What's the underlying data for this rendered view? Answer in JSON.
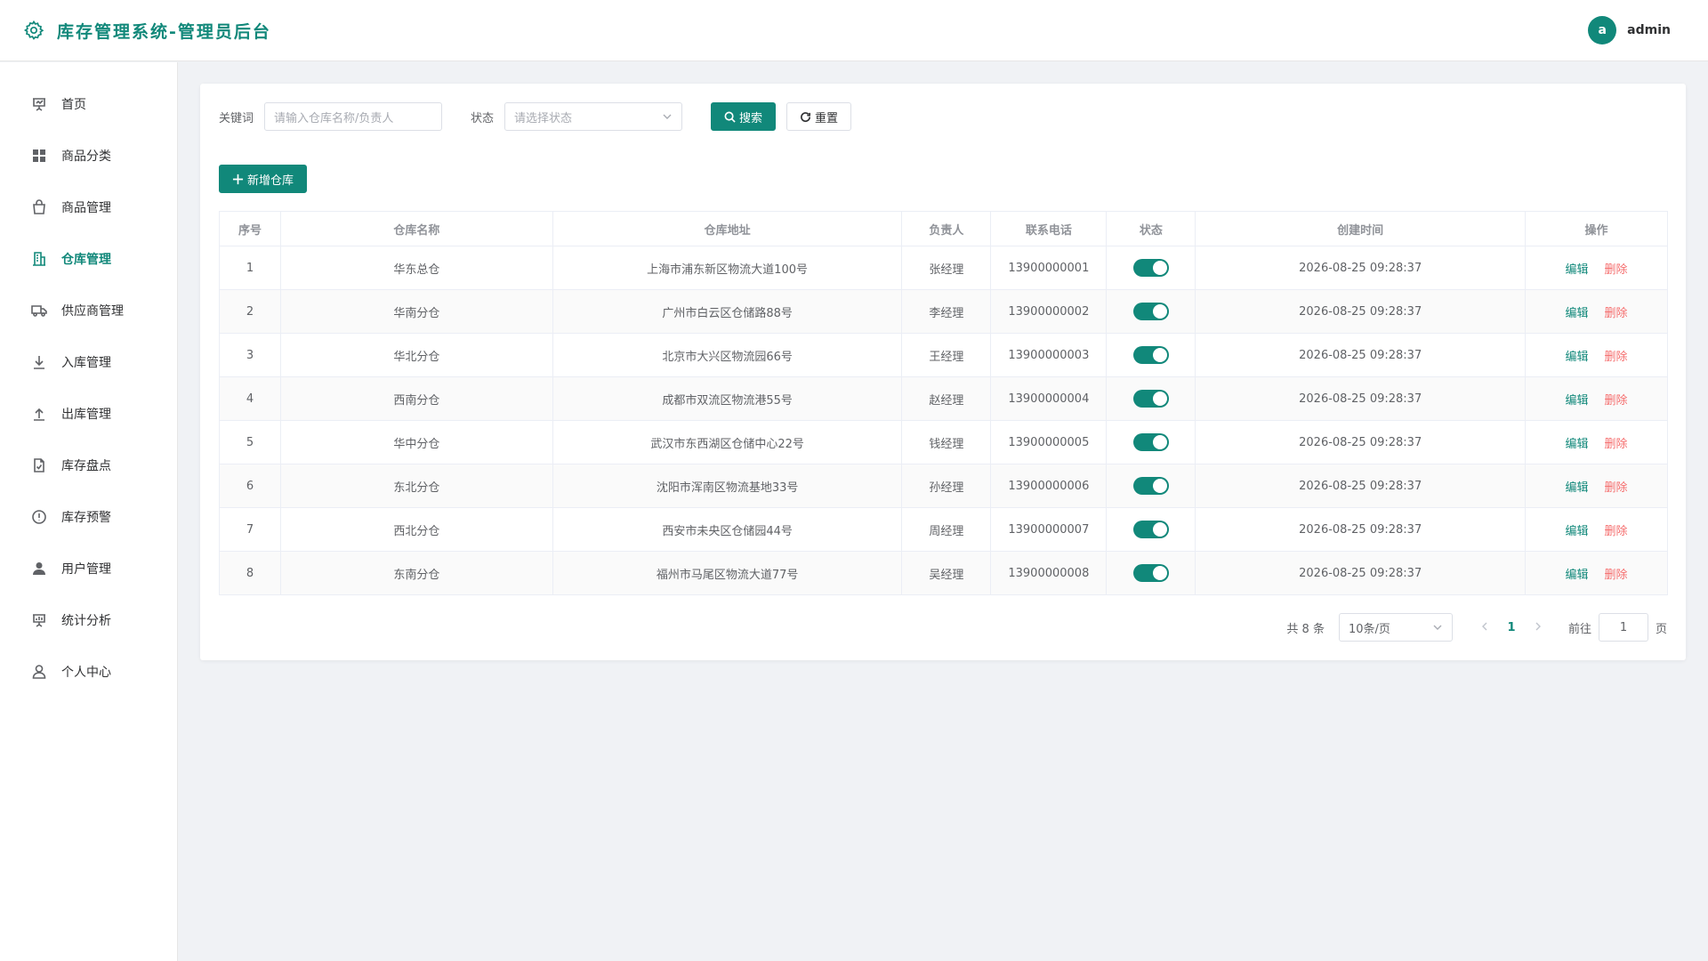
{
  "header": {
    "title": "库存管理系统-管理员后台",
    "avatar_letter": "a",
    "username": "admin"
  },
  "sidebar": {
    "items": [
      {
        "label": "首页",
        "icon": "presentation-icon"
      },
      {
        "label": "商品分类",
        "icon": "grid-icon"
      },
      {
        "label": "商品管理",
        "icon": "bag-icon"
      },
      {
        "label": "仓库管理",
        "icon": "building-icon",
        "active": true
      },
      {
        "label": "供应商管理",
        "icon": "truck-icon"
      },
      {
        "label": "入库管理",
        "icon": "download-icon"
      },
      {
        "label": "出库管理",
        "icon": "upload-icon"
      },
      {
        "label": "库存盘点",
        "icon": "document-check-icon"
      },
      {
        "label": "库存预警",
        "icon": "warning-icon"
      },
      {
        "label": "用户管理",
        "icon": "user-filled-icon"
      },
      {
        "label": "统计分析",
        "icon": "chart-board-icon"
      },
      {
        "label": "个人中心",
        "icon": "user-icon"
      }
    ]
  },
  "search": {
    "keyword_label": "关键词",
    "keyword_placeholder": "请输入仓库名称/负责人",
    "status_label": "状态",
    "status_placeholder": "请选择状态",
    "search_button": "搜索",
    "reset_button": "重置"
  },
  "add_button": "新增仓库",
  "table": {
    "columns": [
      "序号",
      "仓库名称",
      "仓库地址",
      "负责人",
      "联系电话",
      "状态",
      "创建时间",
      "操作"
    ],
    "edit_label": "编辑",
    "delete_label": "删除",
    "rows": [
      {
        "no": "1",
        "name": "华东总仓",
        "address": "上海市浦东新区物流大道100号",
        "manager": "张经理",
        "phone": "13900000001",
        "enabled": true,
        "created": "2026-08-25 09:28:37"
      },
      {
        "no": "2",
        "name": "华南分仓",
        "address": "广州市白云区仓储路88号",
        "manager": "李经理",
        "phone": "13900000002",
        "enabled": true,
        "created": "2026-08-25 09:28:37"
      },
      {
        "no": "3",
        "name": "华北分仓",
        "address": "北京市大兴区物流园66号",
        "manager": "王经理",
        "phone": "13900000003",
        "enabled": true,
        "created": "2026-08-25 09:28:37"
      },
      {
        "no": "4",
        "name": "西南分仓",
        "address": "成都市双流区物流港55号",
        "manager": "赵经理",
        "phone": "13900000004",
        "enabled": true,
        "created": "2026-08-25 09:28:37"
      },
      {
        "no": "5",
        "name": "华中分仓",
        "address": "武汉市东西湖区仓储中心22号",
        "manager": "钱经理",
        "phone": "13900000005",
        "enabled": true,
        "created": "2026-08-25 09:28:37"
      },
      {
        "no": "6",
        "name": "东北分仓",
        "address": "沈阳市浑南区物流基地33号",
        "manager": "孙经理",
        "phone": "13900000006",
        "enabled": true,
        "created": "2026-08-25 09:28:37"
      },
      {
        "no": "7",
        "name": "西北分仓",
        "address": "西安市未央区仓储园44号",
        "manager": "周经理",
        "phone": "13900000007",
        "enabled": true,
        "created": "2026-08-25 09:28:37"
      },
      {
        "no": "8",
        "name": "东南分仓",
        "address": "福州市马尾区物流大道77号",
        "manager": "吴经理",
        "phone": "13900000008",
        "enabled": true,
        "created": "2026-08-25 09:28:37"
      }
    ]
  },
  "pagination": {
    "total_text": "共 8 条",
    "page_size": "10条/页",
    "current_page": "1",
    "goto_label": "前往",
    "goto_value": "1",
    "page_suffix": "页"
  },
  "colors": {
    "primary": "#11887a",
    "danger": "#f56c6c"
  }
}
